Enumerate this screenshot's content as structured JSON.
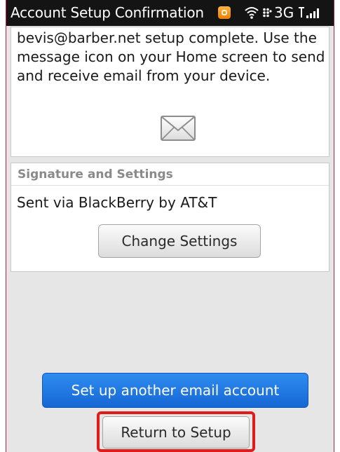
{
  "status_bar": {
    "title": "Account Setup Confirmation",
    "network": "3G",
    "icons": [
      "notification-icon",
      "wifi-icon",
      "blackberry-icon",
      "signal-icon"
    ]
  },
  "confirmation": {
    "message": "bevis@barber.net setup complete. Use the message icon on your Home screen to send and receive email from your device.",
    "icon": "envelope-icon"
  },
  "signature_section": {
    "header": "Signature and Settings",
    "signature": "Sent via BlackBerry by AT&T",
    "change_settings_label": "Change Settings"
  },
  "actions": {
    "setup_another_label": "Set up another email account",
    "return_label": "Return to Setup"
  },
  "colors": {
    "accent_blue": "#1f78e6",
    "highlight_red": "#e11a1a",
    "status_bar_bg": "#141414",
    "notification_orange": "#f07d00"
  }
}
